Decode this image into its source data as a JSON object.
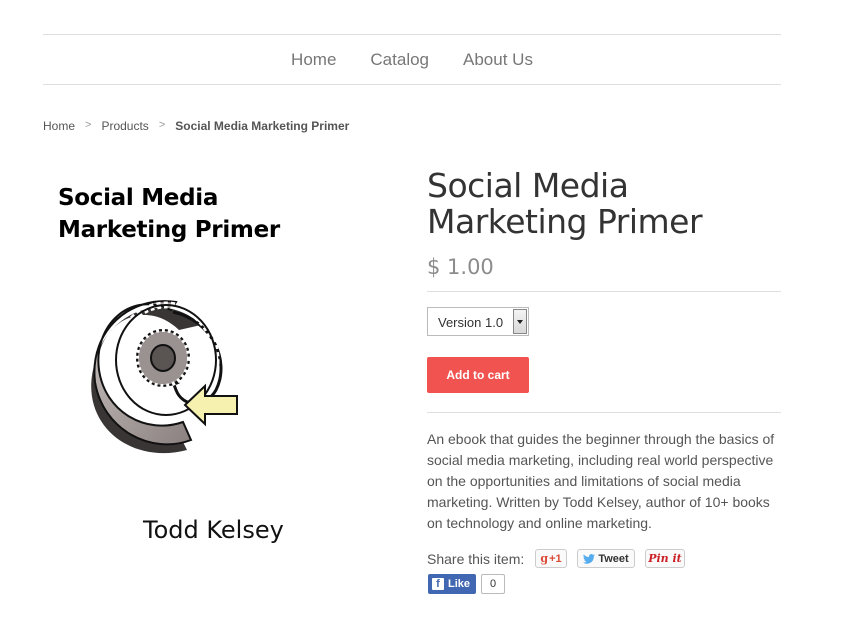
{
  "nav": {
    "items": [
      "Home",
      "Catalog",
      "About Us"
    ]
  },
  "breadcrumb": {
    "home": "Home",
    "products": "Products",
    "current": "Social Media Marketing Primer",
    "separator": ">"
  },
  "cover": {
    "title_line1": "Social Media",
    "title_line2": "Marketing Primer",
    "author": "Todd Kelsey",
    "art_icon": "at-sign-arrow-illustration"
  },
  "product": {
    "title": "Social Media Marketing Primer",
    "price": "$ 1.00",
    "variant_selected": "Version 1.0",
    "add_to_cart": "Add to cart",
    "description": "An ebook that guides the beginner through the basics of social media marketing, including real world perspective on the opportunities and limitations of social media marketing. Written by Todd Kelsey, author of 10+ books on technology and online marketing."
  },
  "share": {
    "label": "Share this item:",
    "gplus": "+1",
    "tweet": "Tweet",
    "pin": "Pin it",
    "like": "Like",
    "like_count": "0"
  },
  "colors": {
    "accent": "#f05350",
    "facebook": "#4267b2"
  }
}
